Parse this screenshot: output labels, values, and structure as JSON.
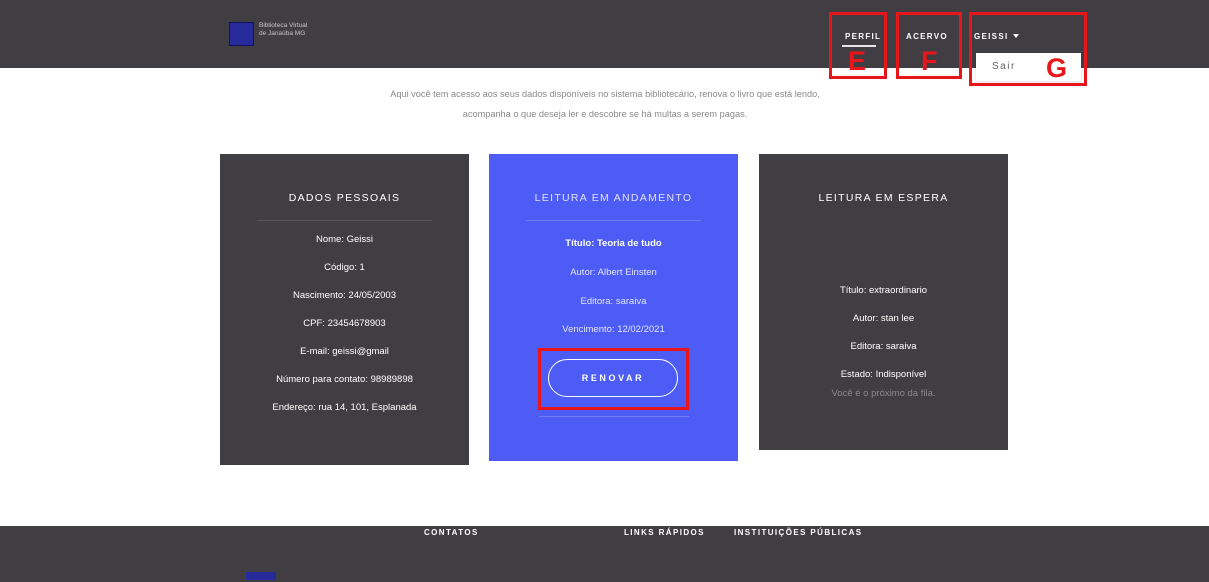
{
  "header": {
    "brand_line1": "Biblioteca Virtual",
    "brand_line2": "de Janaúba MG",
    "nav": {
      "perfil": "PERFIL",
      "acervo": "ACERVO",
      "user": "GEISSI"
    },
    "dropdown": {
      "sair": "Sair"
    }
  },
  "annotations": {
    "e": "E",
    "f": "F",
    "g": "G",
    "color": "#e8151b"
  },
  "intro": {
    "line1": "Aqui você tem acesso aos seus dados disponíveis no sistema bibliotecário, renova o livro que está lendo,",
    "line2": "acompanha o que deseja ler e descobre se há multas a serem pagas."
  },
  "cards": {
    "personal": {
      "title": "DADOS PESSOAIS",
      "rows": [
        "Nome: Geissi",
        "Código: 1",
        "Nascimento: 24/05/2003",
        "CPF: 23454678903",
        "E-mail: geissi@gmail",
        "Número para contato: 98989898",
        "Endereço: rua 14, 101, Esplanada"
      ]
    },
    "reading": {
      "title": "LEITURA EM ANDAMENTO",
      "rows": [
        "Título: Teoria de tudo",
        "Autor: Albert Einsten",
        "Editora: saraiva",
        "Vencimento: 12/02/2021"
      ],
      "button": "RENOVAR"
    },
    "waiting": {
      "title": "LEITURA EM ESPERA",
      "rows": [
        "Título: extraordinario",
        "Autor: stan lee",
        "Editora: saraiva",
        "Estado: Indisponível",
        "Você é o próximo da fila."
      ]
    }
  },
  "footer": {
    "contatos": "CONTATOS",
    "links": "LINKS RÁPIDOS",
    "instituicoes": "INSTITUIÇÕES PÚBLICAS"
  },
  "colors": {
    "header_bg": "#403e42",
    "accent_blue": "#4e5cf6",
    "brand_blue": "#262a9a"
  }
}
